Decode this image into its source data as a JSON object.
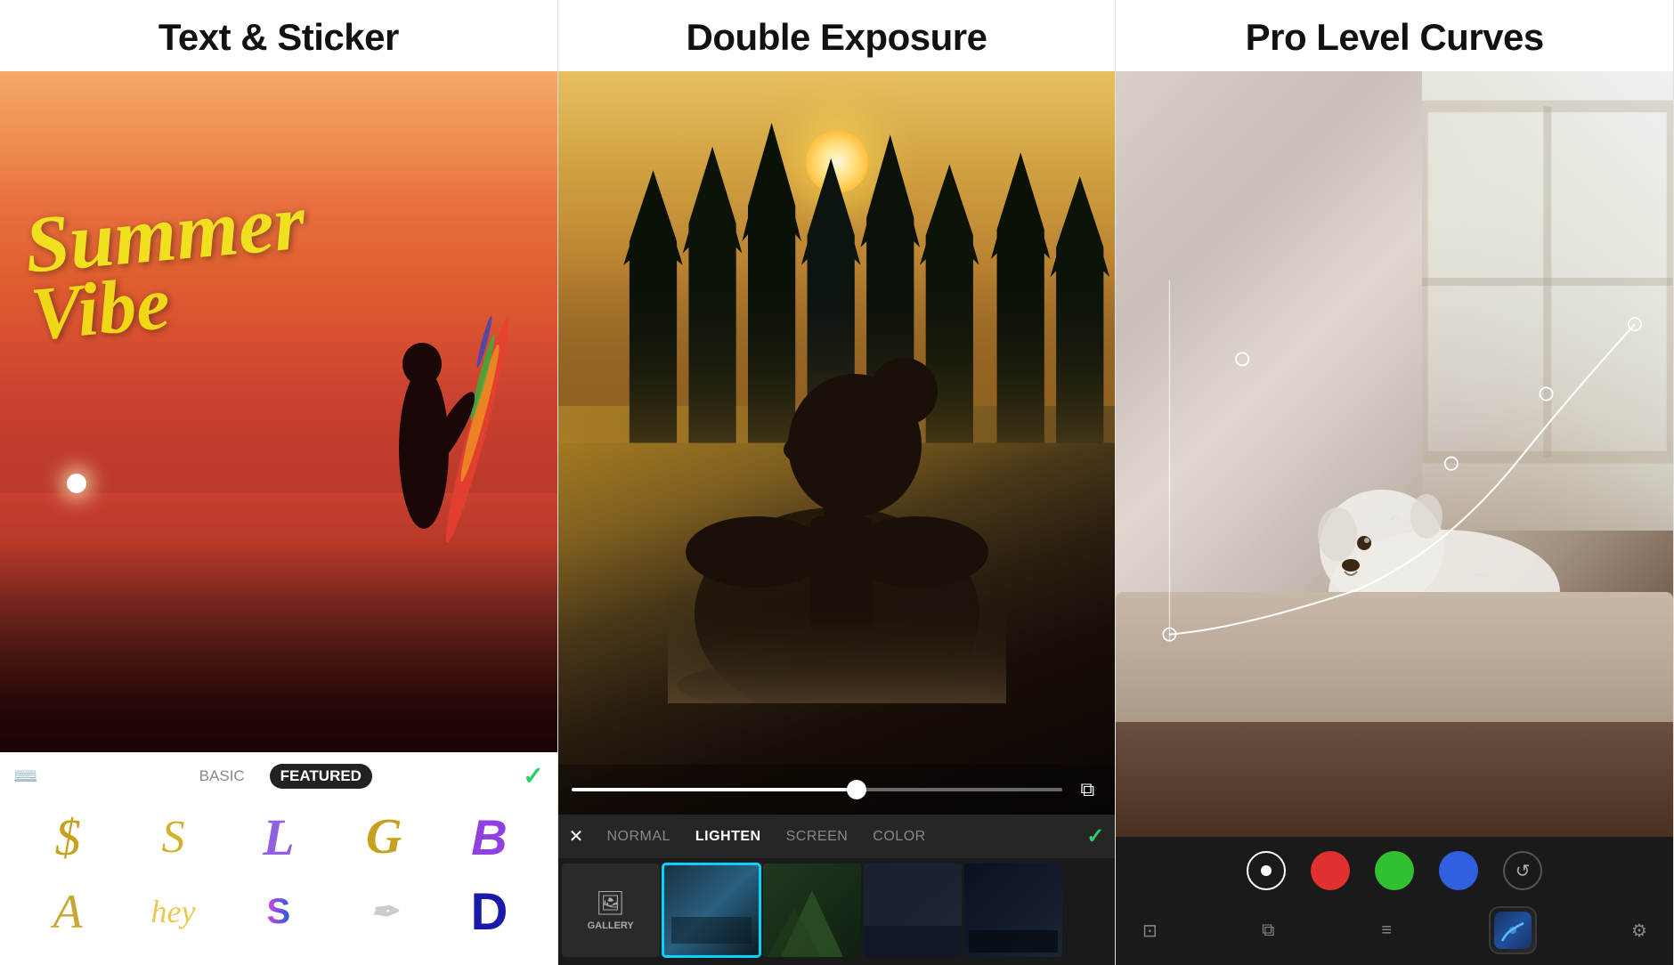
{
  "panel1": {
    "title": "Text & Sticker",
    "title_bold": "Text",
    "title_separator": " & ",
    "title_normal": "Sticker",
    "summer_text": "Summer",
    "vibe_text": "Vibe",
    "tab_basic": "BASIC",
    "tab_featured": "FEATURED",
    "check": "✓",
    "stickers": [
      {
        "label": "$",
        "style": "s1"
      },
      {
        "label": "S",
        "style": "s2"
      },
      {
        "label": "L",
        "style": "s3"
      },
      {
        "label": "G",
        "style": "s4"
      },
      {
        "label": "B",
        "style": "s5"
      },
      {
        "label": "A",
        "style": "s6"
      },
      {
        "label": "hey",
        "style": "s7"
      },
      {
        "label": "S",
        "style": "s8"
      },
      {
        "label": "/",
        "style": "s9"
      },
      {
        "label": "D",
        "style": "s10"
      }
    ]
  },
  "panel2": {
    "title": "Double Exposure",
    "blend_modes": [
      "NORMAL",
      "LIGHTEN",
      "SCREEN",
      "COLOR"
    ],
    "active_blend": "LIGHTEN",
    "check": "✓",
    "gallery_label": "GALLERY"
  },
  "panel3": {
    "title": "Pro Level Curves",
    "channels": [
      {
        "label": "white",
        "type": "white-ch"
      },
      {
        "label": "red",
        "type": "red-ch"
      },
      {
        "label": "green",
        "type": "green-ch"
      },
      {
        "label": "blue",
        "type": "blue-ch"
      },
      {
        "label": "reset",
        "type": "reset-ch"
      }
    ],
    "bottom_icons": [
      "crop",
      "layers",
      "sliders",
      "app",
      "settings"
    ]
  }
}
